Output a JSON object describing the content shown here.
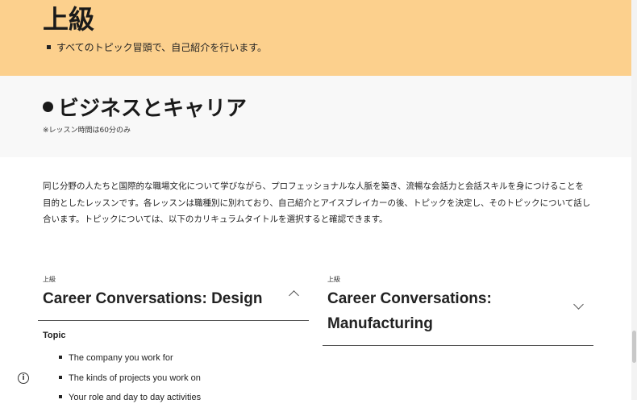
{
  "top": {
    "level_heading": "上級",
    "bullet": "すべてのトピック冒頭で、自己紹介を行います。"
  },
  "section": {
    "title": "ビジネスとキャリア",
    "note": "※レッスン時間は60分のみ",
    "intro": "同じ分野の人たちと国際的な職場文化について学びながら、プロフェッショナルな人脈を築き、流暢な会話力と会話スキルを身につけることを目的としたレッスンです。各レッスンは職種別に別れており、自己紹介とアイスブレイカーの後、トピックを決定し、そのトピックについて話し合います。トピックについては、以下のカリキュラムタイトルを選択すると確認できます。"
  },
  "cards": [
    {
      "level": "上級",
      "title": "Career Conversations: Design",
      "expanded": true,
      "topic_label": "Topic",
      "topics": [
        "The company you work for",
        "The kinds of projects you work on",
        "Your role and day to day activities"
      ]
    },
    {
      "level": "上級",
      "title": "Career Conversations: Manufacturing",
      "expanded": false
    }
  ],
  "icons": {
    "info": "info-icon",
    "chevron_up": "chevron-up-icon",
    "chevron_down": "chevron-down-icon"
  },
  "colors": {
    "top_band": "#fcd08d",
    "section_band": "#f8f8f8"
  }
}
